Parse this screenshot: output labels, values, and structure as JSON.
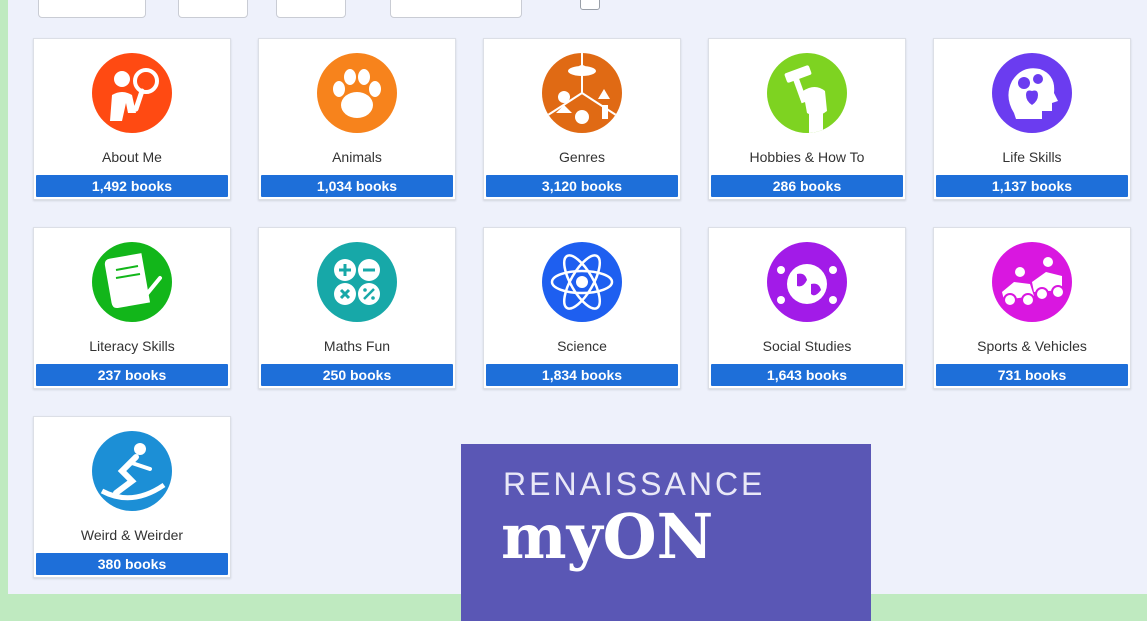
{
  "topbar": {
    "option_text": "..."
  },
  "categories": [
    {
      "name": "About Me",
      "count": "1,492 books",
      "icon": "person-magnifier-icon",
      "color": "#ff4a12"
    },
    {
      "name": "Animals",
      "count": "1,034 books",
      "icon": "paw-icon",
      "color": "#f7831c"
    },
    {
      "name": "Genres",
      "count": "3,120 books",
      "icon": "genres-icon",
      "color": "#e06a14"
    },
    {
      "name": "Hobbies & How To",
      "count": "286 books",
      "icon": "hammer-fist-icon",
      "color": "#7ed321"
    },
    {
      "name": "Life Skills",
      "count": "1,137 books",
      "icon": "head-heart-gears-icon",
      "color": "#6b3cf0"
    },
    {
      "name": "Literacy Skills",
      "count": "237 books",
      "icon": "scroll-quill-icon",
      "color": "#12b61a"
    },
    {
      "name": "Maths Fun",
      "count": "250 books",
      "icon": "math-operators-icon",
      "color": "#17a8a8"
    },
    {
      "name": "Science",
      "count": "1,834 books",
      "icon": "atom-icon",
      "color": "#1e5ff0"
    },
    {
      "name": "Social Studies",
      "count": "1,643 books",
      "icon": "globe-people-icon",
      "color": "#a21be8"
    },
    {
      "name": "Sports & Vehicles",
      "count": "731 books",
      "icon": "racing-cars-icon",
      "color": "#d917e0"
    },
    {
      "name": "Weird & Weirder",
      "count": "380 books",
      "icon": "skier-icon",
      "color": "#1c8fd6"
    }
  ],
  "logo": {
    "brand": "RENAISSANCE",
    "product": "myON"
  }
}
